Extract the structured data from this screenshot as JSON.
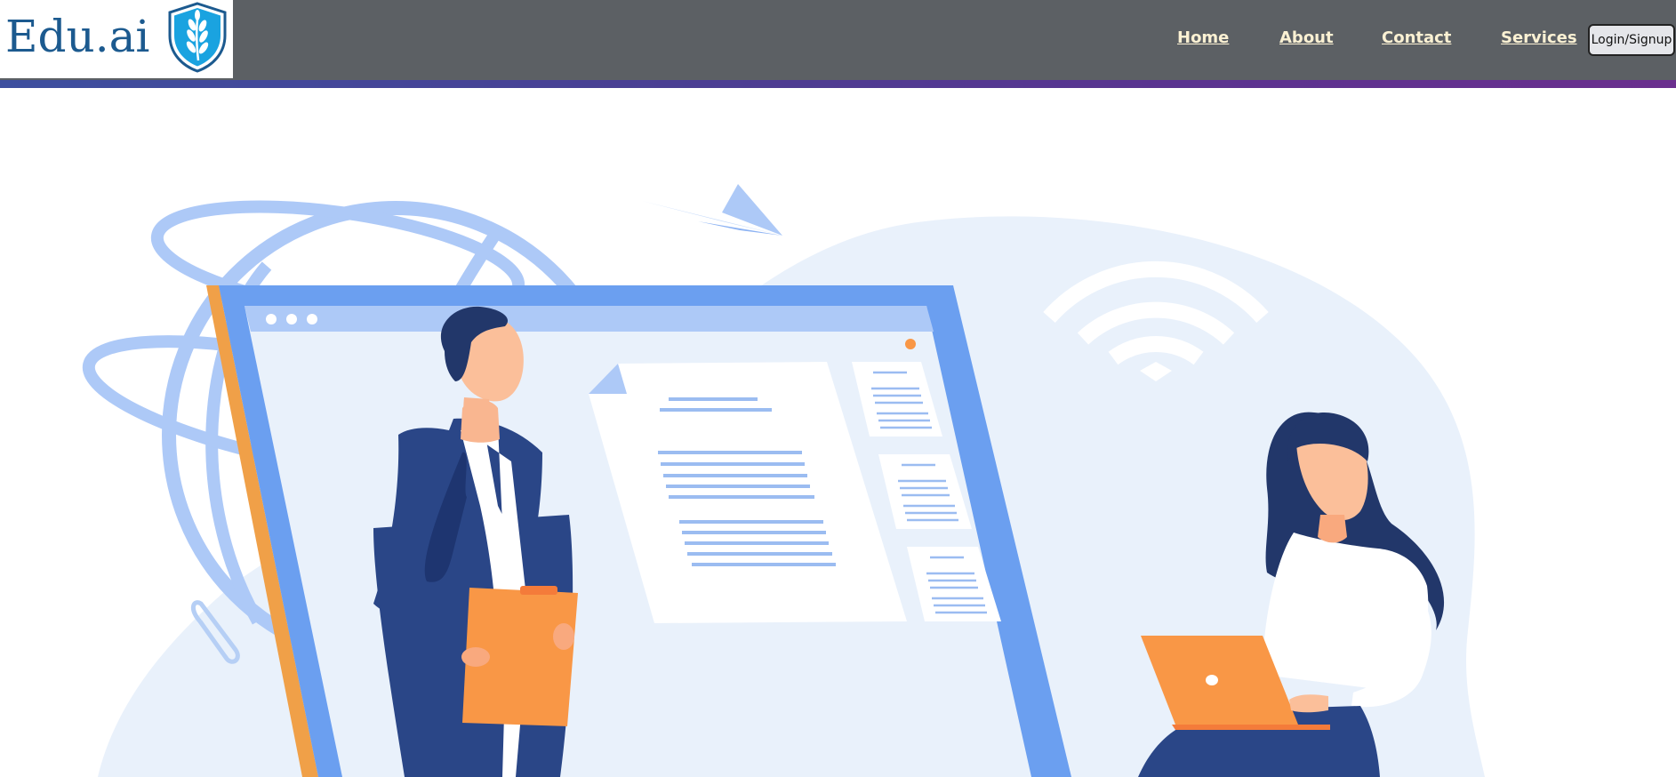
{
  "brand": {
    "logo_text": "Edu.ai",
    "logo_icon": "shield-wheat-icon",
    "logo_color": "#1c5a8f"
  },
  "nav": {
    "links": [
      {
        "label": "Home"
      },
      {
        "label": "About"
      },
      {
        "label": "Contact"
      },
      {
        "label": "Services"
      }
    ],
    "login_label": "Login/Signup",
    "bar_color": "#5c6064",
    "link_color": "#fbf1d3"
  },
  "hero": {
    "illustration": "online-education-illustration",
    "palette": {
      "light_blue": "#adc9f7",
      "blue": "#6b9ff0",
      "pale_bg": "#e9f1fb",
      "navy": "#2a4687",
      "orange": "#f99746",
      "skin": "#fbbf9a"
    }
  }
}
